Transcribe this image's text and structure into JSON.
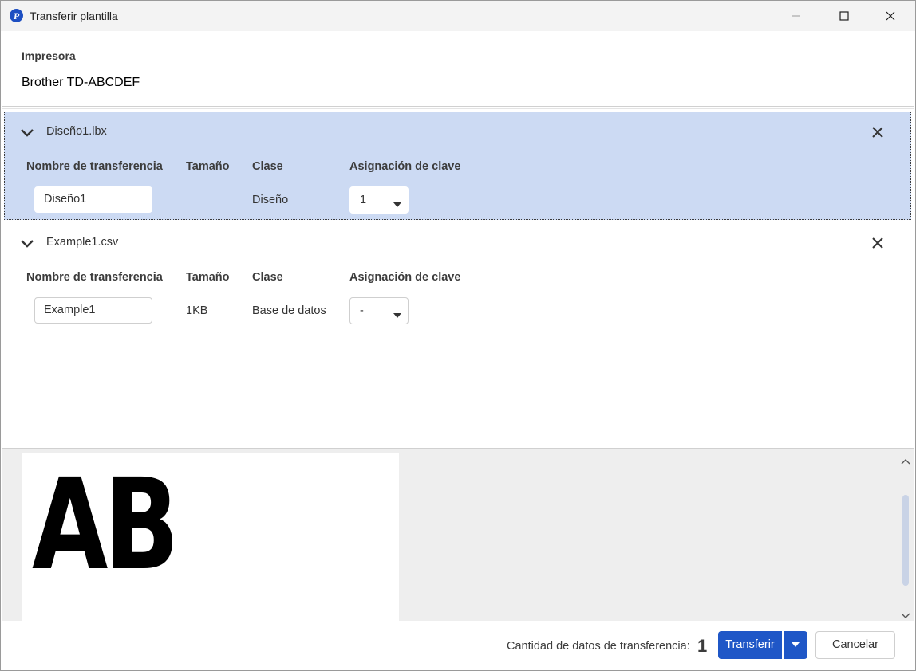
{
  "window": {
    "title": "Transferir plantilla"
  },
  "printer": {
    "label": "Impresora",
    "name": "Brother TD-ABCDEF"
  },
  "columns": {
    "name": "Nombre de transferencia",
    "size": "Tamaño",
    "class": "Clase",
    "key": "Asignación de clave"
  },
  "files": [
    {
      "filename": "Diseño1.lbx",
      "transfer_name": "Diseño1",
      "size": "",
      "class": "Diseño",
      "key": "1",
      "selected": true
    },
    {
      "filename": "Example1.csv",
      "transfer_name": "Example1",
      "size": "1KB",
      "class": "Base de datos",
      "key": "-",
      "selected": false
    }
  ],
  "preview": {
    "text": "AB"
  },
  "footer": {
    "count_label": "Cantidad de datos de transferencia:",
    "count_value": "1",
    "transfer_label": "Transferir",
    "cancel_label": "Cancelar"
  },
  "colors": {
    "accent": "#1f57c7",
    "selected_bg": "#ccdaf3"
  },
  "icons": {
    "app": "brother-p-touch-icon",
    "expand": "chevron-down-icon",
    "remove": "close-icon",
    "dropdown": "caret-down-icon"
  }
}
